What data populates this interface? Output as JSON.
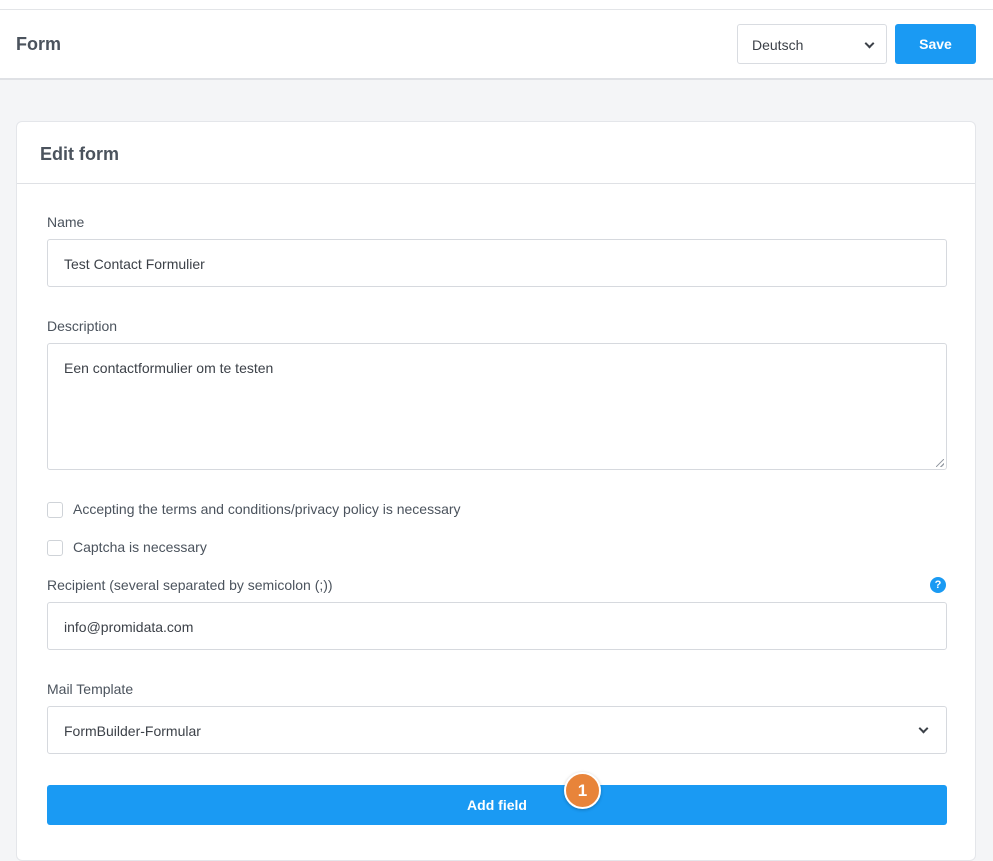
{
  "header": {
    "title": "Form",
    "language_selected": "Deutsch",
    "save_label": "Save"
  },
  "card": {
    "title": "Edit form",
    "name_label": "Name",
    "name_value": "Test Contact Formulier",
    "description_label": "Description",
    "description_value": "Een contactformulier om te testen",
    "terms_checkbox_label": "Accepting the terms and conditions/privacy policy is necessary",
    "terms_checked": false,
    "captcha_checkbox_label": "Captcha is necessary",
    "captcha_checked": false,
    "recipient_label": "Recipient (several separated by semicolon (;))",
    "recipient_help_icon": "?",
    "recipient_value": "info@promidata.com",
    "mail_template_label": "Mail Template",
    "mail_template_value": "FormBuilder-Formular",
    "add_field_label": "Add field"
  },
  "step_badge": "1",
  "colors": {
    "accent": "#1a9af3",
    "badge": "#e8843a"
  },
  "icons": {
    "language_dropdown": "chevron-down-icon",
    "template_dropdown": "chevron-down-icon",
    "help": "question-circle-icon"
  }
}
